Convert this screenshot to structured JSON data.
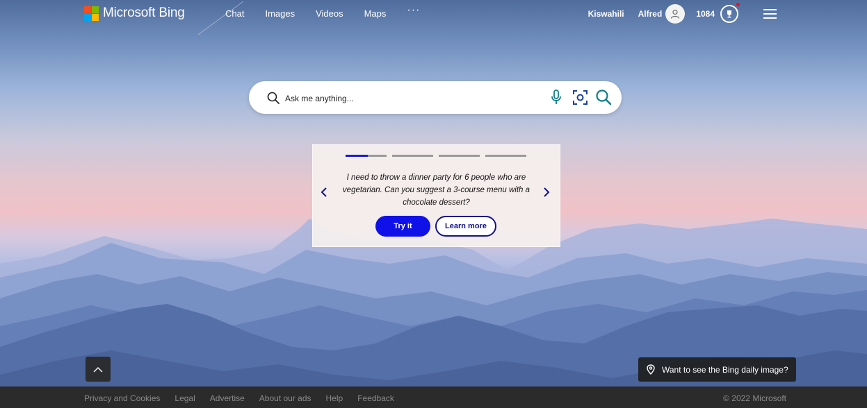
{
  "header": {
    "logo_text": "Microsoft Bing",
    "nav": [
      "Chat",
      "Images",
      "Videos",
      "Maps"
    ],
    "more": "···",
    "language": "Kiswahili",
    "user_name": "Alfred",
    "points": "1084"
  },
  "search": {
    "placeholder": "Ask me anything..."
  },
  "card": {
    "text": "I need to throw a dinner party for 6 people who are vegetarian. Can you suggest a 3-course menu with a chocolate dessert?",
    "try_label": "Try it",
    "learn_label": "Learn more",
    "active_slide_progress": 0.55
  },
  "daily_image": {
    "label": "Want to see the Bing daily image?"
  },
  "footer": {
    "links": [
      "Privacy and Cookies",
      "Legal",
      "Advertise",
      "About our ads",
      "Help",
      "Feedback"
    ],
    "copyright": "© 2022 Microsoft"
  },
  "colors": {
    "ms_red": "#f25022",
    "ms_green": "#7fba00",
    "ms_blue": "#00a4ef",
    "ms_yellow": "#ffb900",
    "accent_teal": "#0f7d8c",
    "try_button": "#1010e8",
    "learn_border": "#12128a",
    "footer_bg": "#2b2b2b"
  }
}
